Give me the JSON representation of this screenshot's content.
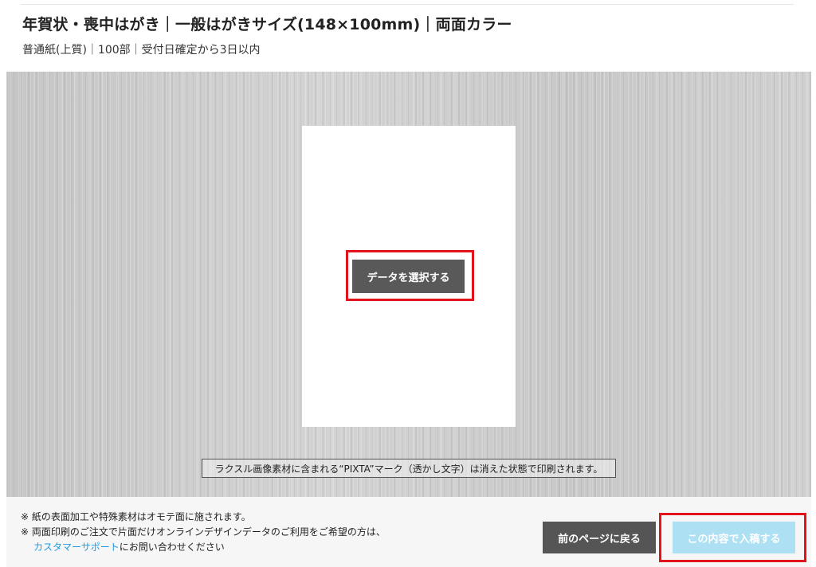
{
  "product": {
    "title": "年賀状・喪中はがき｜一般はがきサイズ(148×100mm)｜両面カラー",
    "spec": "普通紙(上質)｜100部｜受付日確定から3日以内"
  },
  "preview": {
    "select_button_label": "データを選択する",
    "watermark_notice": "ラクスル画像素材に含まれる“PIXTA”マーク（透かし文字）は消えた状態で印刷されます。"
  },
  "footer": {
    "note_1": "※ 紙の表面加工や特殊素材はオモテ面に施されます。",
    "note_2": "※ 両面印刷のご注文で片面だけオンラインデザインデータのご利用をご希望の方は、",
    "support_link": "カスタマーサポート",
    "note_2_suffix": "にお問い合わせください",
    "back_button_label": "前のページに戻る",
    "submit_button_label": "この内容で入稿する"
  },
  "colors": {
    "highlight": "#e3131b",
    "link": "#1e9be0",
    "submit_disabled": "#aee0f4",
    "dark_button": "#555555"
  }
}
